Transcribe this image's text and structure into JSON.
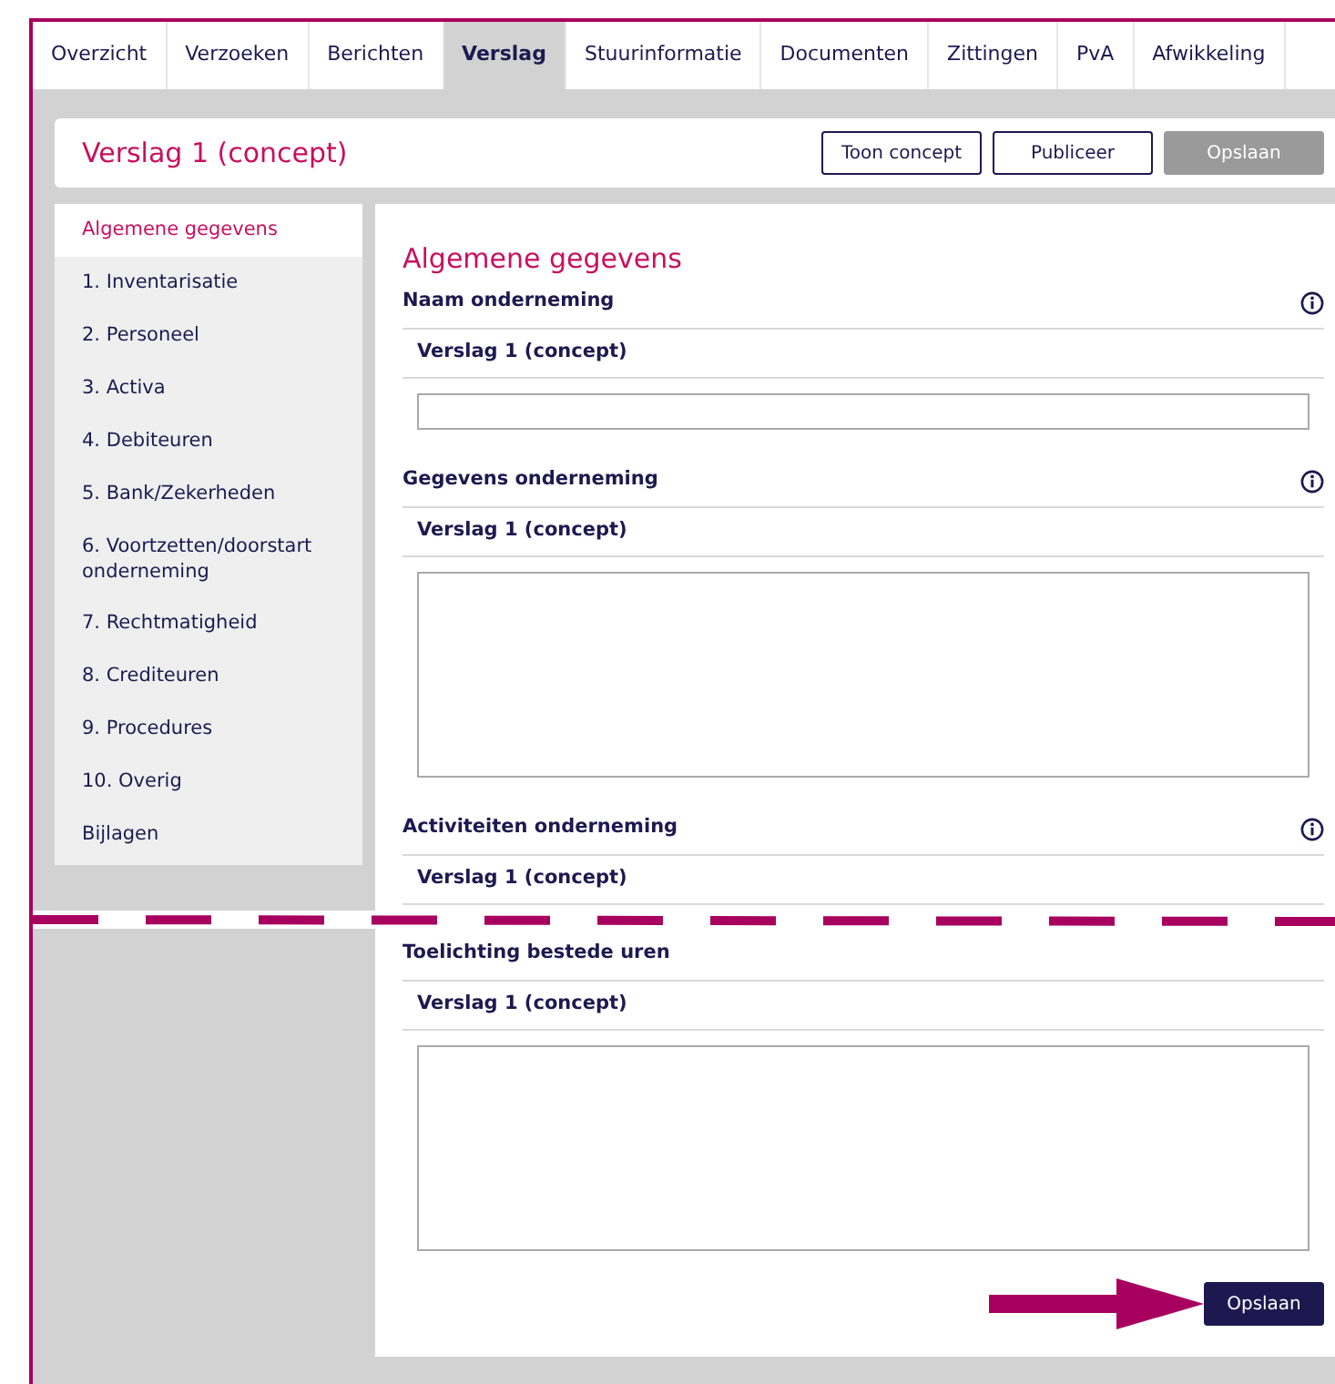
{
  "tabs": [
    {
      "label": "Overzicht",
      "selected": false
    },
    {
      "label": "Verzoeken",
      "selected": false
    },
    {
      "label": "Berichten",
      "selected": false
    },
    {
      "label": "Verslag",
      "selected": true
    },
    {
      "label": "Stuurinformatie",
      "selected": false
    },
    {
      "label": "Documenten",
      "selected": false
    },
    {
      "label": "Zittingen",
      "selected": false
    },
    {
      "label": "PvA",
      "selected": false
    },
    {
      "label": "Afwikkeling",
      "selected": false
    }
  ],
  "header": {
    "title": "Verslag 1 (concept)",
    "buttons": [
      {
        "label": "Toon concept",
        "disabled": false
      },
      {
        "label": "Publiceer",
        "disabled": false
      },
      {
        "label": "Opslaan",
        "disabled": true
      }
    ]
  },
  "sidebar": {
    "items": [
      {
        "label": "Algemene gegevens",
        "selected": true
      },
      {
        "label": "1. Inventarisatie",
        "selected": false
      },
      {
        "label": "2. Personeel",
        "selected": false
      },
      {
        "label": "3. Activa",
        "selected": false
      },
      {
        "label": "4. Debiteuren",
        "selected": false
      },
      {
        "label": "5. Bank/Zekerheden",
        "selected": false
      },
      {
        "label": "6. Voortzetten/doorstart onderneming",
        "selected": false
      },
      {
        "label": "7. Rechtmatigheid",
        "selected": false
      },
      {
        "label": "8. Crediteuren",
        "selected": false
      },
      {
        "label": "9. Procedures",
        "selected": false
      },
      {
        "label": "10. Overig",
        "selected": false
      },
      {
        "label": "Bijlagen",
        "selected": false
      }
    ]
  },
  "main": {
    "heading": "Algemene gegevens",
    "sections": [
      {
        "kind": "input",
        "title": "Naam onderneming",
        "info": true,
        "subheader": "Verslag 1 (concept)"
      },
      {
        "kind": "textarea",
        "title": "Gegevens onderneming",
        "info": true,
        "subheader": "Verslag 1 (concept)"
      },
      {
        "kind": "cut",
        "title": "Activiteiten onderneming",
        "info": true,
        "subheader": "Verslag 1 (concept)"
      },
      {
        "kind": "textarea",
        "title": "Toelichting bestede uren",
        "info": false,
        "subheader": "Verslag 1 (concept)"
      }
    ],
    "save_button": "Opslaan"
  }
}
